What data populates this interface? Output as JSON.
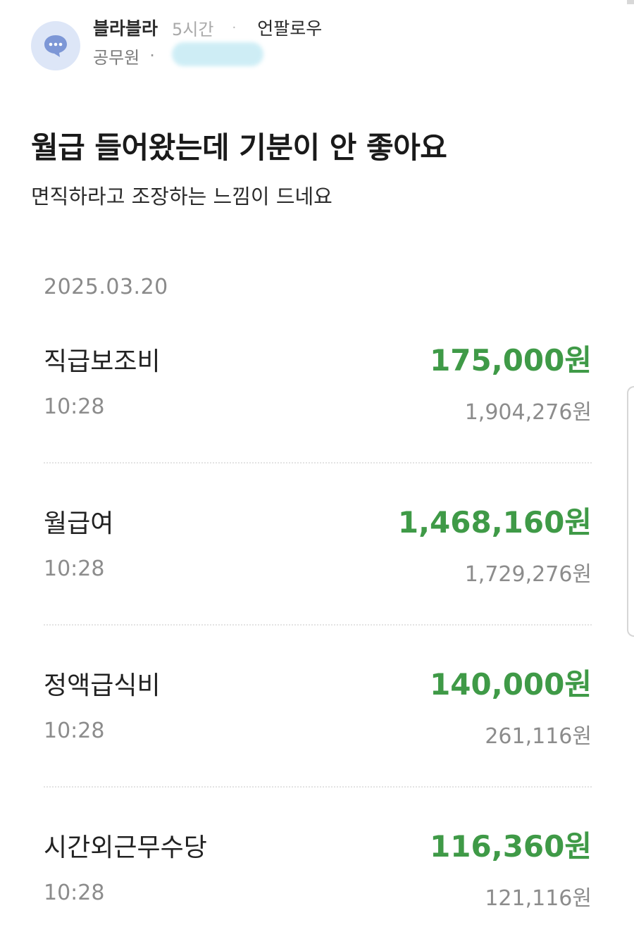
{
  "header": {
    "author": "블라블라",
    "time_ago": "5시간",
    "separator": "·",
    "unfollow_label": "언팔로우",
    "company": "공무원",
    "company_separator": "·",
    "avatar_icon": "chat-bubble-icon",
    "accent_avatar_color": "#dde6f7"
  },
  "post": {
    "title": "월급 들어왔는데 기분이 안 좋아요",
    "body": "면직하라고 조장하는 느낌이 드네요"
  },
  "transactions": {
    "date": "2025.03.20",
    "amount_color": "#3f9a47",
    "items": [
      {
        "label": "직급보조비",
        "amount": "175,000원",
        "time": "10:28",
        "balance": "1,904,276원"
      },
      {
        "label": "월급여",
        "amount": "1,468,160원",
        "time": "10:28",
        "balance": "1,729,276원"
      },
      {
        "label": "정액급식비",
        "amount": "140,000원",
        "time": "10:28",
        "balance": "261,116원"
      },
      {
        "label": "시간외근무수당",
        "amount": "116,360원",
        "time": "10:28",
        "balance": "121,116원"
      }
    ]
  }
}
